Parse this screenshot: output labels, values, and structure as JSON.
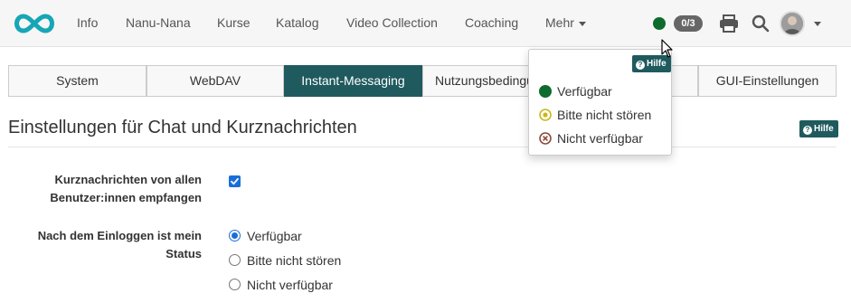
{
  "nav": {
    "items": [
      {
        "label": "Info"
      },
      {
        "label": "Nanu-Nana"
      },
      {
        "label": "Kurse"
      },
      {
        "label": "Katalog"
      },
      {
        "label": "Video Collection"
      },
      {
        "label": "Coaching"
      },
      {
        "label": "Mehr"
      }
    ],
    "chat_badge": "0/3",
    "status_color": "#0e6b2e",
    "icons": [
      "infinity-logo-icon",
      "print-icon",
      "search-icon",
      "avatar"
    ]
  },
  "tabs": [
    {
      "label": "System"
    },
    {
      "label": "WebDAV"
    },
    {
      "label": "Instant-Messaging",
      "active": true
    },
    {
      "label": "Nutzungsbedingungen"
    },
    {
      "label": ""
    },
    {
      "label": "GUI-Einstellungen"
    }
  ],
  "section": {
    "title": "Einstellungen für Chat und Kurznachrichten",
    "help_label": "Hilfe"
  },
  "form": {
    "receive_label_line1": "Kurznachrichten von allen",
    "receive_label_line2": "Benutzer:innen empfangen",
    "receive_checked": true,
    "status_label_line1": "Nach dem Einloggen ist mein",
    "status_label_line2": "Status",
    "status_options": [
      {
        "label": "Verfügbar",
        "checked": true
      },
      {
        "label": "Bitte nicht stören",
        "checked": false
      },
      {
        "label": "Nicht verfügbar",
        "checked": false
      }
    ]
  },
  "dropdown": {
    "help_label": "Hilfe",
    "items": [
      {
        "label": "Verfügbar",
        "color": "#0e6b2e"
      },
      {
        "label": "Bitte nicht stören",
        "color": "#c9b81a"
      },
      {
        "label": "Nicht verfügbar",
        "color": "#8a4a3a"
      }
    ]
  },
  "colors": {
    "accent": "#1f5a5e",
    "primary_input": "#1a6ed8"
  }
}
